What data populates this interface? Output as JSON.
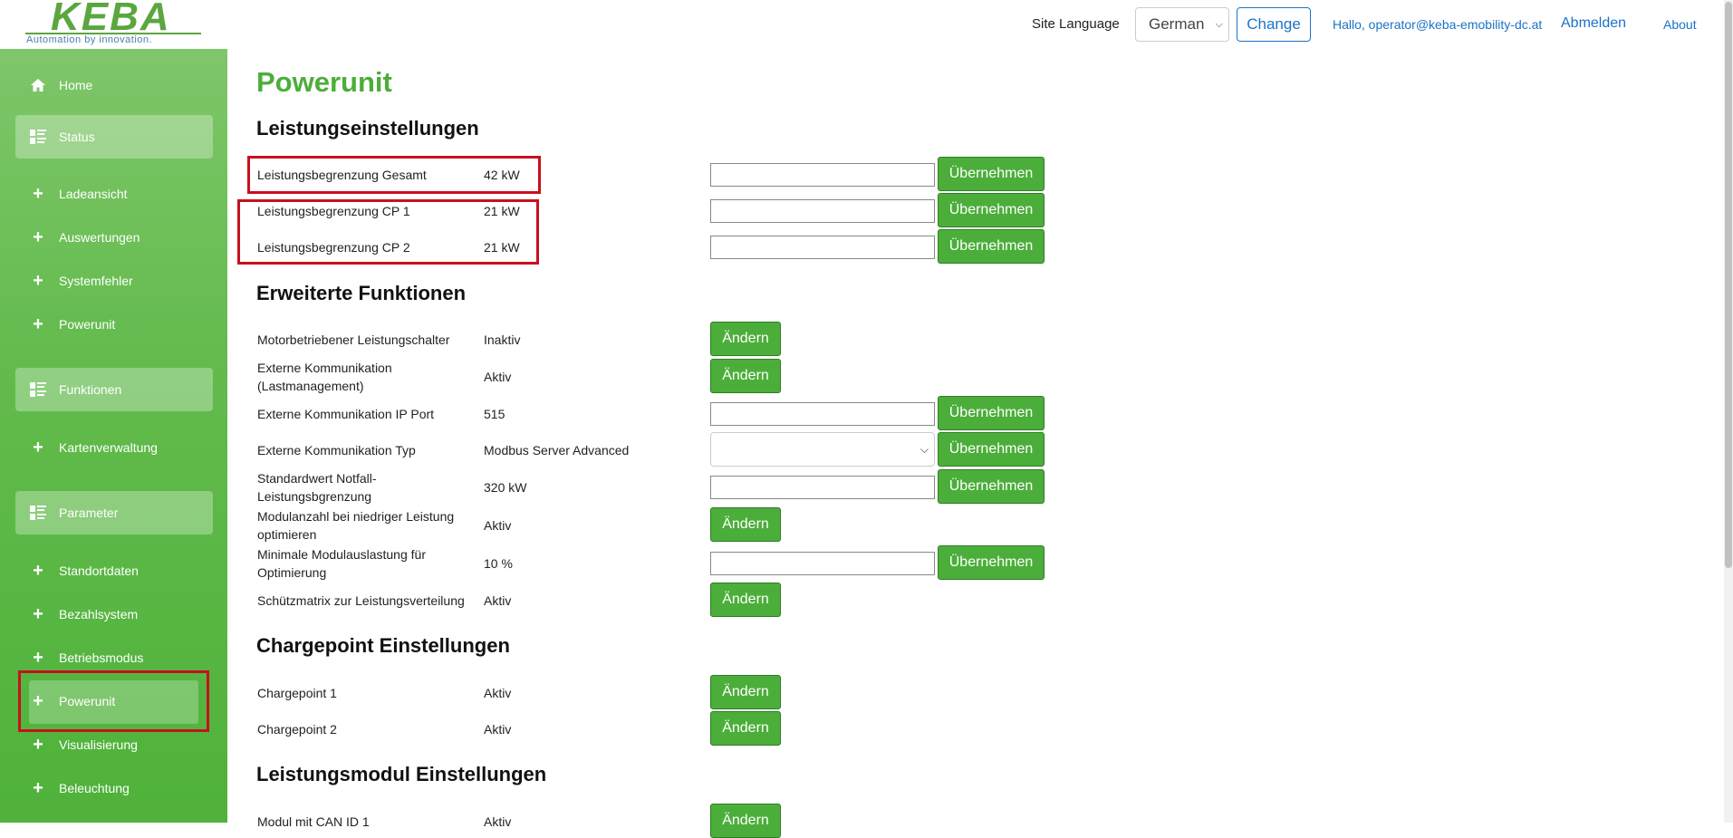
{
  "brand": {
    "logo_text": "KEBA",
    "tagline": "Automation by innovation."
  },
  "header": {
    "site_language_label": "Site Language",
    "language_selected": "German",
    "change_label": "Change",
    "user_greeting": "Hallo, operator@keba-emobility-dc.at",
    "logout_label": "Abmelden",
    "about_label": "About"
  },
  "sidebar": {
    "home": "Home",
    "status_group": "Status",
    "status_items": [
      "Ladeansicht",
      "Auswertungen",
      "Systemfehler",
      "Powerunit"
    ],
    "functions_group": "Funktionen",
    "functions_items": [
      "Kartenverwaltung"
    ],
    "params_group": "Parameter",
    "params_items": [
      "Standortdaten",
      "Bezahlsystem",
      "Betriebsmodus",
      "Powerunit",
      "Visualisierung",
      "Beleuchtung"
    ]
  },
  "main": {
    "title": "Powerunit",
    "apply_label": "Übernehmen",
    "edit_label": "Ändern",
    "sections": {
      "power": {
        "title": "Leistungseinstellungen",
        "rows": [
          {
            "label": "Leistungsbegrenzung Gesamt",
            "value": "42 kW"
          },
          {
            "label": "Leistungsbegrenzung CP 1",
            "value": "21 kW"
          },
          {
            "label": "Leistungsbegrenzung CP 2",
            "value": "21 kW"
          }
        ]
      },
      "extended": {
        "title": "Erweiterte Funktionen",
        "rows": [
          {
            "label": "Motorbetriebener Leistungschalter",
            "value": "Inaktiv"
          },
          {
            "label": "Externe Kommunikation (Lastmanagement)",
            "value": "Aktiv"
          },
          {
            "label": "Externe Kommunikation IP Port",
            "value": "515"
          },
          {
            "label": "Externe Kommunikation Typ",
            "value": "Modbus Server Advanced"
          },
          {
            "label": "Standardwert Notfall-Leistungsbgrenzung",
            "value": "320 kW"
          },
          {
            "label": "Modulanzahl bei niedriger Leistung optimieren",
            "value": "Aktiv"
          },
          {
            "label": "Minimale Modulauslastung für Optimierung",
            "value": "10 %"
          },
          {
            "label": "Schützmatrix zur Leistungsverteilung",
            "value": "Aktiv"
          }
        ]
      },
      "chargepoint": {
        "title": "Chargepoint Einstellungen",
        "rows": [
          {
            "label": "Chargepoint 1",
            "value": "Aktiv"
          },
          {
            "label": "Chargepoint 2",
            "value": "Aktiv"
          }
        ]
      },
      "module": {
        "title": "Leistungsmodul Einstellungen",
        "rows": [
          {
            "label": "Modul mit CAN ID 1",
            "value": "Aktiv"
          }
        ]
      }
    }
  },
  "colors": {
    "accent": "#4cae3a",
    "link": "#1a73c8",
    "highlight": "#c8101e"
  }
}
